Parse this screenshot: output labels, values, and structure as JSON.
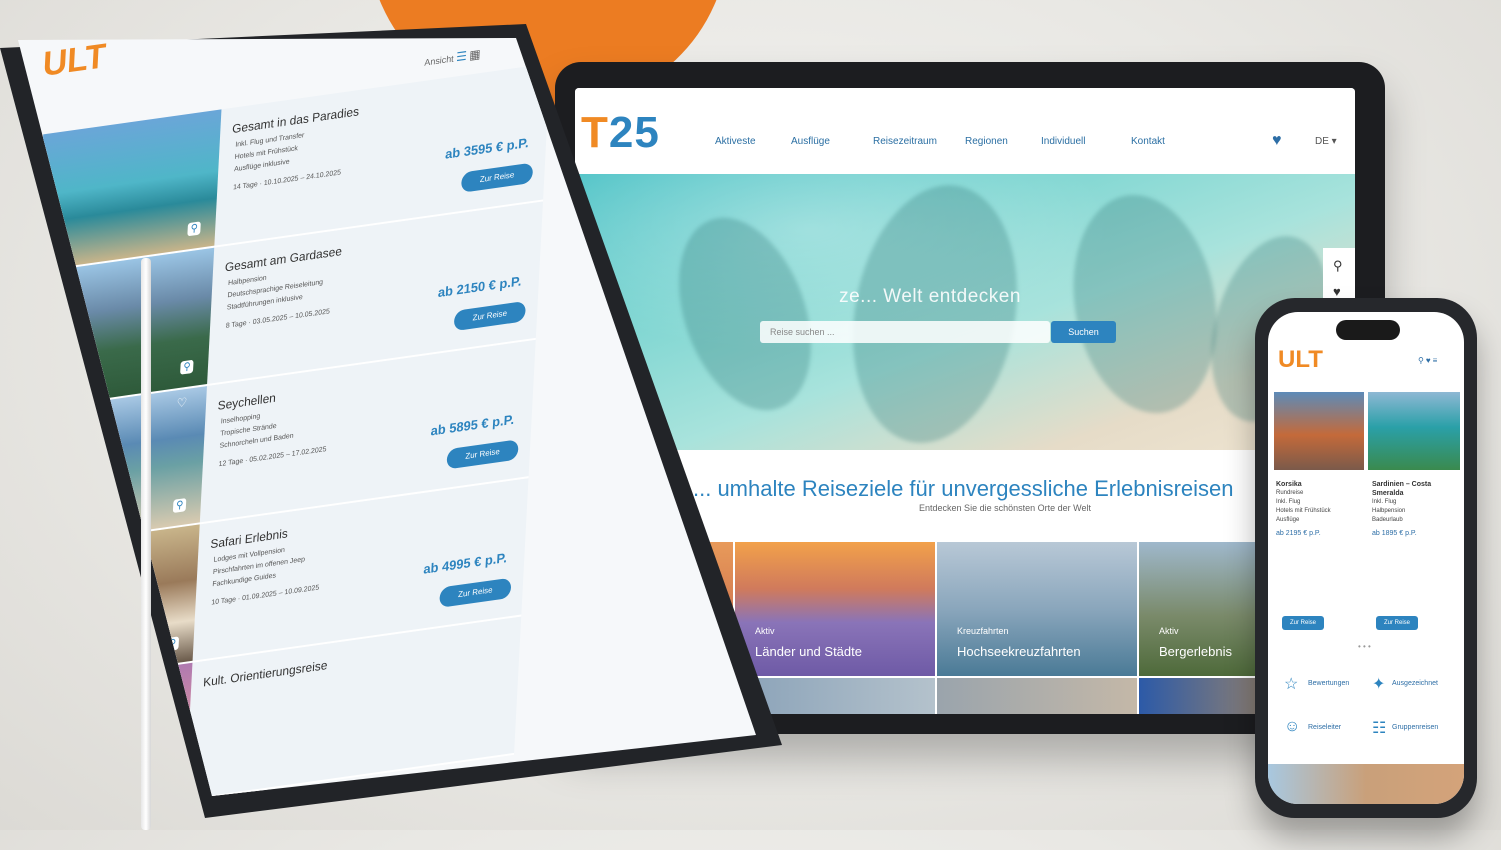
{
  "brand": {
    "name": "ULT",
    "anniversary_number": "25"
  },
  "colors": {
    "accent_orange": "#ec7c22",
    "brand_blue": "#2d84bf"
  },
  "desktop": {
    "nav": [
      "Aktiveste",
      "Ausflüge",
      "Reisezeitraum",
      "Regionen",
      "Individuell",
      "Kontakt"
    ],
    "language": "DE ▾",
    "hero_title": "ze... Welt entdecken",
    "search_placeholder": "Reise suchen ...",
    "search_button": "Suchen",
    "section_title": "... umhalte Reiseziele für unvergessliche Erlebnisreisen",
    "section_subtitle": "Entdecken Sie die schönsten Orte der Welt",
    "cards": [
      {
        "label_small": "Aktiv",
        "label_big": "Länder und Städte"
      },
      {
        "label_small": "Kreuzfahrten",
        "label_big": "Hochseekreuzfahrten"
      },
      {
        "label_small": "Aktiv",
        "label_big": "Bergerlebnis"
      }
    ]
  },
  "tablet": {
    "view_label": "Ansicht",
    "tours": [
      {
        "title": "Gesamt in das Paradies",
        "bullets": [
          "Inkl. Flug und Transfer",
          "Hotels mit Frühstück",
          "Ausflüge inklusive"
        ],
        "meta": "14 Tage · 10.10.2025 – 24.10.2025",
        "price": "ab 3595 € p.P.",
        "button": "Zur Reise"
      },
      {
        "title": "Gesamt am Gardasee",
        "bullets": [
          "Halbpension",
          "Deutschsprachige Reiseleitung",
          "Stadtführungen inklusive"
        ],
        "meta": "8 Tage · 03.05.2025 – 10.05.2025",
        "price": "ab 2150 € p.P.",
        "button": "Zur Reise"
      },
      {
        "title": "Seychellen",
        "bullets": [
          "Inselhopping",
          "Tropische Strände",
          "Schnorcheln und Baden"
        ],
        "meta": "12 Tage · 05.02.2025 – 17.02.2025",
        "price": "ab 5895 € p.P.",
        "button": "Zur Reise"
      },
      {
        "title": "Safari Erlebnis",
        "bullets": [
          "Lodges mit Vollpension",
          "Pirschfahrten im offenen Jeep",
          "Fachkundige Guides"
        ],
        "meta": "10 Tage · 01.09.2025 – 10.09.2025",
        "price": "ab 4995 € p.P.",
        "button": "Zur Reise"
      },
      {
        "title": "Kult. Orientierungsreise",
        "bullets": [],
        "meta": "",
        "price": "",
        "button": ""
      }
    ]
  },
  "phone": {
    "tours": [
      {
        "title": "Korsika",
        "lines": [
          "Rundreise",
          "Inkl. Flug",
          "Hotels mit Frühstück",
          "Ausflüge"
        ],
        "price": "ab 2195 € p.P.",
        "button": "Zur Reise"
      },
      {
        "title": "Sardinien – Costa Smeralda",
        "lines": [
          "Inkl. Flug",
          "Halbpension",
          "Badeurlaub"
        ],
        "price": "ab 1895 € p.P.",
        "button": "Zur Reise"
      }
    ],
    "more": "• • •",
    "features": [
      "Bewertungen",
      "Ausgezeichnet",
      "Reiseleiter",
      "Gruppenreisen"
    ]
  }
}
